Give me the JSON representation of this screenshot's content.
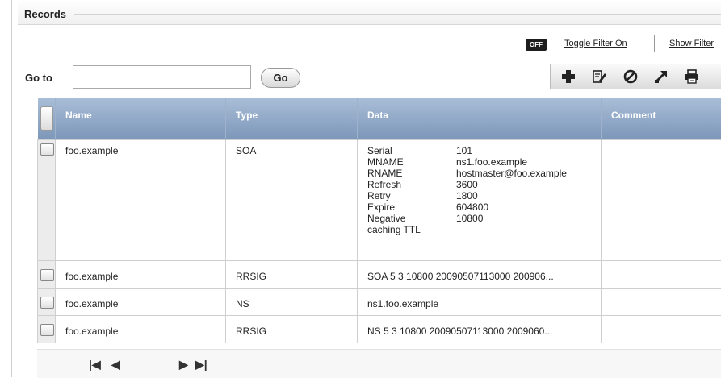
{
  "records": {
    "title": "Records"
  },
  "filter": {
    "badge": "OFF",
    "toggle_label": "Toggle Filter On",
    "show_label": "Show Filter"
  },
  "goto": {
    "label": "Go to",
    "value": "",
    "button": "Go"
  },
  "toolbar": {
    "icons": [
      "add-icon",
      "edit-icon",
      "disable-icon",
      "export-icon",
      "print-icon"
    ]
  },
  "table": {
    "columns": [
      "Name",
      "Type",
      "Data",
      "Comment"
    ],
    "rows": [
      {
        "name": "foo.example",
        "type": "SOA",
        "data_pairs": [
          {
            "k": "Serial",
            "v": "101"
          },
          {
            "k": "MNAME",
            "v": "ns1.foo.example"
          },
          {
            "k": "RNAME",
            "v": "hostmaster@foo.example"
          },
          {
            "k": "Refresh",
            "v": "3600"
          },
          {
            "k": "Retry",
            "v": "1800"
          },
          {
            "k": "Expire",
            "v": "604800"
          },
          {
            "k": "Negative caching TTL",
            "v": "10800"
          }
        ],
        "comment": ""
      },
      {
        "name": "foo.example",
        "type": "RRSIG",
        "data": "SOA 5 3 10800 20090507113000 200906...",
        "comment": ""
      },
      {
        "name": "foo.example",
        "type": "NS",
        "data": "ns1.foo.example",
        "comment": ""
      },
      {
        "name": "foo.example",
        "type": "RRSIG",
        "data": "NS 5 3 10800 20090507113000 2009060...",
        "comment": ""
      }
    ]
  },
  "pager": {
    "first": "|◀",
    "prev": "◀",
    "next": "▶",
    "last": "▶|"
  }
}
